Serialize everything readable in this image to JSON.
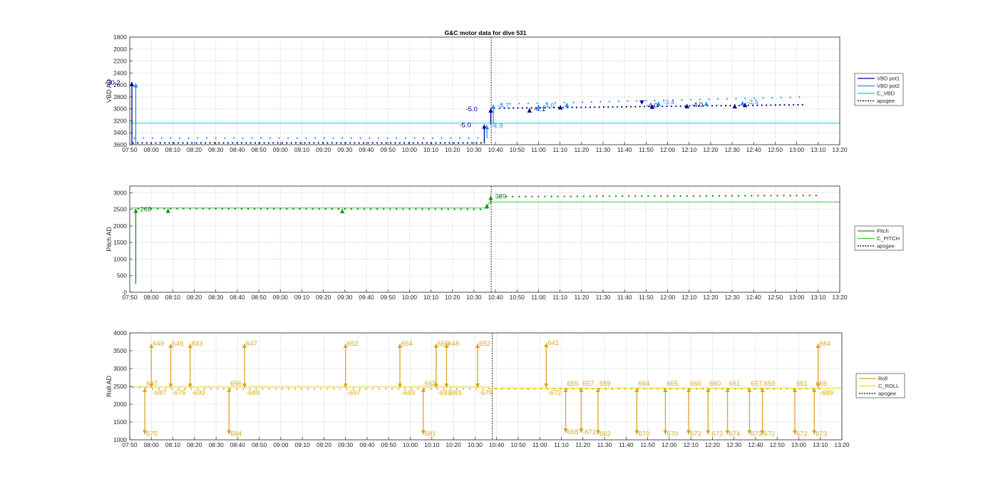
{
  "chart_data": [
    {
      "type": "line",
      "title": "G&C motor data for dive 531",
      "ylabel": "VBD AD",
      "ylim": [
        1800,
        3600
      ],
      "y_reversed": true,
      "yticks": [
        "1800",
        "2000",
        "2200",
        "2400",
        "2600",
        "2800",
        "3000",
        "3200",
        "3400",
        "3600"
      ],
      "xlim": [
        "07:50",
        "13:20"
      ],
      "xticks": [
        "07:50",
        "08:00",
        "08:10",
        "08:20",
        "08:30",
        "08:40",
        "08:50",
        "09:00",
        "09:10",
        "09:20",
        "09:30",
        "09:40",
        "09:50",
        "10:00",
        "10:10",
        "10:20",
        "10:30",
        "10:40",
        "10:50",
        "11:00",
        "11:10",
        "11:20",
        "11:30",
        "11:40",
        "11:50",
        "12:00",
        "12:10",
        "12:20",
        "12:30",
        "12:40",
        "12:50",
        "13:00",
        "13:10",
        "13:20"
      ],
      "grid": true,
      "legend_position": "right",
      "legend": [
        "VBD pot1",
        "VBD pot2",
        "C_VBD",
        "apogee"
      ],
      "apogee": "10:38",
      "series": [
        {
          "name": "VBD pot1",
          "color": "#00008b",
          "dots": [
            [
              7.84,
              3570
            ],
            [
              10.56,
              3580
            ],
            [
              10.77,
              2980
            ],
            [
              12.4,
              2980
            ],
            [
              13.0,
              2950
            ],
            [
              13.05,
              2950
            ],
            [
              13.1,
              2900
            ],
            [
              13.14,
              2850
            ],
            [
              13.17,
              2800
            ]
          ]
        },
        {
          "name": "VBD pot2",
          "color": "#1e90ff",
          "dots": [
            [
              7.84,
              3490
            ],
            [
              10.62,
              3480
            ],
            [
              10.78,
              2960
            ],
            [
              12.4,
              2940
            ],
            [
              13.0,
              2920
            ],
            [
              13.05,
              2920
            ],
            [
              13.1,
              2880
            ],
            [
              13.14,
              2830
            ],
            [
              13.17,
              2780
            ]
          ]
        },
        {
          "name": "C_VBD",
          "color": "#00cfe0",
          "values": [
            [
              7.84,
              3240
            ],
            [
              13.33,
              3240
            ]
          ]
        }
      ],
      "events": [
        {
          "t": 7.85,
          "from": 3600,
          "to": 2550,
          "series": "VBD pot1",
          "label": "-30.2"
        },
        {
          "t": 7.88,
          "from": 3600,
          "to": 2570,
          "series": "VBD pot2"
        },
        {
          "t": 10.58,
          "from": 3580,
          "to": 3260,
          "series": "VBD pot1",
          "label": "-5.0"
        },
        {
          "t": 10.6,
          "from": 3490,
          "to": 3270,
          "series": "VBD pot2",
          "label": "-4.9"
        },
        {
          "t": 10.63,
          "from": 3260,
          "to": 2990,
          "series": "VBD pot1",
          "label": "-5.0"
        },
        {
          "t": 10.65,
          "from": 3270,
          "to": 2930,
          "series": "VBD pot2",
          "label": "-4.7"
        },
        {
          "t": 10.93,
          "from": 3010,
          "to": 2990,
          "series": "VBD pot1",
          "label": "-4.1"
        },
        {
          "t": 11.0,
          "from": 2990,
          "to": 2930,
          "series": "VBD pot2",
          "label": "-4.0"
        },
        {
          "t": 11.17,
          "from": 2950,
          "to": 2940,
          "series": "VBD pot1"
        },
        {
          "t": 11.22,
          "from": 2950,
          "to": 2900,
          "series": "VBD pot2"
        },
        {
          "t": 11.8,
          "from": 2930,
          "to": 2930,
          "series": "VBD pot1",
          "label": "-4.0"
        },
        {
          "t": 11.88,
          "from": 2940,
          "to": 2930,
          "series": "VBD pot1"
        },
        {
          "t": 11.93,
          "from": 2920,
          "to": 2880,
          "series": "VBD pot2",
          "label": "-3.4"
        },
        {
          "t": 12.15,
          "from": 2930,
          "to": 2920,
          "series": "VBD pot1",
          "label": "-4.0"
        },
        {
          "t": 12.3,
          "from": 2920,
          "to": 2880,
          "series": "VBD pot2"
        },
        {
          "t": 12.52,
          "from": 2930,
          "to": 2920,
          "series": "VBD pot1"
        },
        {
          "t": 12.58,
          "from": 2920,
          "to": 2870,
          "series": "VBD pot2",
          "label": "-3.5"
        },
        {
          "t": 12.6,
          "from": 2920,
          "to": 2900,
          "series": "VBD pot1"
        }
      ]
    },
    {
      "type": "line",
      "ylabel": "Pitch AD",
      "ylim": [
        0,
        3200
      ],
      "yticks": [
        "0",
        "500",
        "1000",
        "1500",
        "2000",
        "2500",
        "3000"
      ],
      "xlim": [
        "07:50",
        "13:20"
      ],
      "grid": true,
      "legend_position": "right",
      "legend": [
        "Pitch",
        "C_PITCH",
        "apogee"
      ],
      "apogee": "10:38",
      "series": [
        {
          "name": "Pitch",
          "color": "#228b22",
          "dots_start": [
            7.88,
            2530
          ],
          "dots_end": [
            10.58,
            2500
          ],
          "dots_start2": [
            10.68,
            2880
          ],
          "dots_end2": [
            13.17,
            2910
          ]
        },
        {
          "name": "C_PITCH",
          "color": "#32cd32",
          "values": [
            [
              7.84,
              2540
            ],
            [
              10.6,
              2540
            ],
            [
              10.62,
              2720
            ],
            [
              13.33,
              2720
            ]
          ]
        }
      ],
      "events": [
        {
          "t": 7.88,
          "from": 250,
          "to": 2520,
          "series": "Pitch",
          "label": "268"
        },
        {
          "t": 8.13,
          "from": 2510,
          "to": 2520,
          "series": "Pitch"
        },
        {
          "t": 9.48,
          "from": 2500,
          "to": 2510,
          "series": "Pitch"
        },
        {
          "t": 10.6,
          "from": 2510,
          "to": 2660,
          "series": "Pitch"
        },
        {
          "t": 10.63,
          "from": 2660,
          "to": 2910,
          "series": "Pitch",
          "label": "389"
        }
      ]
    },
    {
      "type": "line",
      "ylabel": "Roll AD",
      "ylim": [
        1000,
        4000
      ],
      "yticks": [
        "1000",
        "1500",
        "2000",
        "2500",
        "3000",
        "3500",
        "4000"
      ],
      "xlim": [
        "07:50",
        "13:20"
      ],
      "grid": true,
      "legend_position": "right",
      "legend": [
        "Roll",
        "C_ROLL",
        "apogee"
      ],
      "apogee": "10:38",
      "series": [
        {
          "name": "Roll",
          "color": "#daa520",
          "level": 2430
        },
        {
          "name": "C_ROLL",
          "color": "#f0e000",
          "values": [
            [
              7.84,
              2480
            ],
            [
              10.6,
              2480
            ],
            [
              10.62,
              2450
            ],
            [
              13.33,
              2450
            ]
          ]
        }
      ],
      "events": [
        {
          "t": 7.95,
          "from": 2460,
          "to": 1150,
          "label_up": "647",
          "label_down": "675"
        },
        {
          "t": 8.0,
          "from": 2460,
          "to": 3700,
          "label_up": "649",
          "label_down": "-687"
        },
        {
          "t": 8.15,
          "from": 2460,
          "to": 3700,
          "label_up": "645",
          "label_down": "-675"
        },
        {
          "t": 8.3,
          "from": 2460,
          "to": 3700,
          "label_up": "643",
          "label_down": "-693"
        },
        {
          "t": 8.6,
          "from": 2460,
          "to": 1150,
          "label_up": "656",
          "label_down": "684"
        },
        {
          "t": 8.72,
          "from": 2460,
          "to": 3700,
          "label_up": "647",
          "label_down": "-689"
        },
        {
          "t": 9.5,
          "from": 2460,
          "to": 3700,
          "label_up": "652",
          "label_down": "-697"
        },
        {
          "t": 9.92,
          "from": 2460,
          "to": 3700,
          "label_up": "654",
          "label_down": "-689"
        },
        {
          "t": 10.1,
          "from": 2460,
          "to": 1150,
          "label_up": "662",
          "label_down": "681"
        },
        {
          "t": 10.2,
          "from": 2460,
          "to": 3700,
          "label_up": "655",
          "label_down": "-691"
        },
        {
          "t": 10.28,
          "from": 2460,
          "to": 3700,
          "label_up": "648",
          "label_down": "-683"
        },
        {
          "t": 10.52,
          "from": 2460,
          "to": 3700,
          "label_up": "652",
          "label_down": "-679"
        },
        {
          "t": 11.05,
          "from": 2460,
          "to": 3720,
          "label_up": "641",
          "label_down": "-672"
        },
        {
          "t": 11.2,
          "from": 2460,
          "to": 1200,
          "label_up": "655",
          "label_down": "668"
        },
        {
          "t": 11.32,
          "from": 2460,
          "to": 1200,
          "label_up": "657",
          "label_down": "-671"
        },
        {
          "t": 11.45,
          "from": 2460,
          "to": 1150,
          "label_up": "659",
          "label_down": "662"
        },
        {
          "t": 11.75,
          "from": 2460,
          "to": 1150,
          "label_up": "664",
          "label_down": "670"
        },
        {
          "t": 11.97,
          "from": 2460,
          "to": 1150,
          "label_up": "655",
          "label_down": "670"
        },
        {
          "t": 12.15,
          "from": 2460,
          "to": 1150,
          "label_up": "660",
          "label_down": "672"
        },
        {
          "t": 12.3,
          "from": 2460,
          "to": 1150,
          "label_up": "660",
          "label_down": "-672"
        },
        {
          "t": 12.45,
          "from": 2460,
          "to": 1150,
          "label_up": "661",
          "label_down": "674"
        },
        {
          "t": 12.62,
          "from": 2460,
          "to": 1150,
          "label_up": "657",
          "label_down": "673"
        },
        {
          "t": 12.72,
          "from": 2460,
          "to": 1150,
          "label_up": "659",
          "label_down": "672"
        },
        {
          "t": 12.97,
          "from": 2460,
          "to": 1150,
          "label_up": "661",
          "label_down": "672"
        },
        {
          "t": 13.12,
          "from": 2460,
          "to": 1150,
          "label_up": "665",
          "label_down": "673"
        },
        {
          "t": 13.15,
          "from": 2460,
          "to": 3700,
          "label_up": "664",
          "label_down": "-689"
        }
      ]
    }
  ]
}
